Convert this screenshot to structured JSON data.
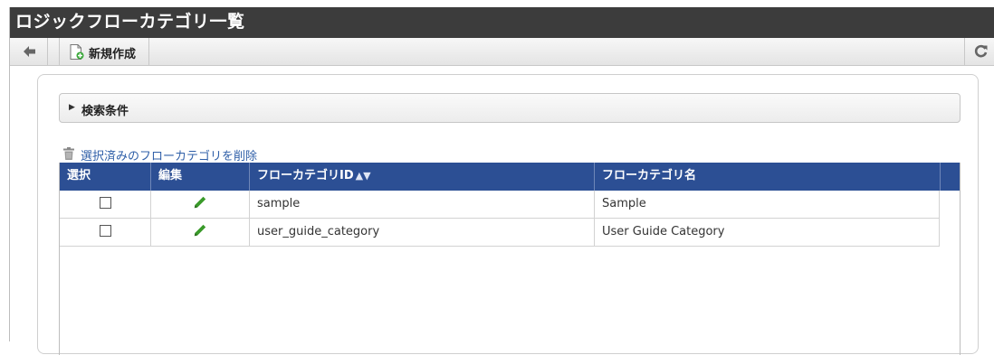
{
  "window": {
    "title": "ロジックフローカテゴリ一覧"
  },
  "toolbar": {
    "back_icon": "arrow-left-icon",
    "new_label": "新規作成",
    "new_icon": "new-document-icon",
    "refresh_icon": "refresh-icon"
  },
  "search": {
    "label": "検索条件",
    "icon": "triangle-right-icon"
  },
  "actions": {
    "delete_label": "選択済みのフローカテゴリを削除",
    "delete_icon": "trash-icon"
  },
  "table": {
    "headers": {
      "select": "選択",
      "edit": "編集",
      "category_id": "フローカテゴリID",
      "category_name": "フローカテゴリ名"
    },
    "sort_icon": "sort-icon",
    "edit_icon": "pencil-icon",
    "rows": [
      {
        "id": "sample",
        "name": "Sample"
      },
      {
        "id": "user_guide_category",
        "name": "User Guide Category"
      }
    ]
  },
  "colors": {
    "title_bar": "#3c3c3c",
    "header_blue": "#2c4f94",
    "link_blue": "#2f5fa8",
    "pencil_green": "#3a9a2a"
  }
}
